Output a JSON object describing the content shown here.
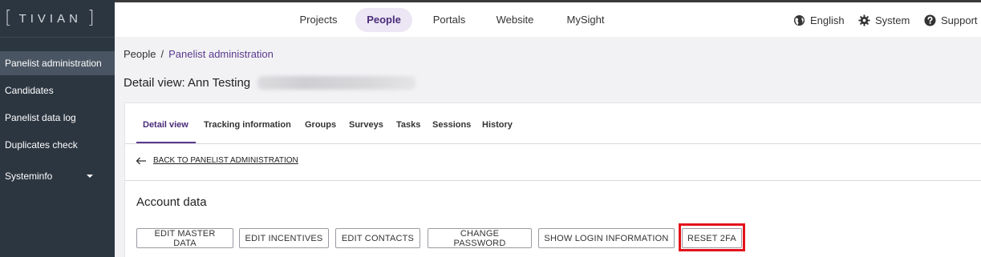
{
  "brand": {
    "logo_text": "TIVIAN",
    "bracket_left": "[",
    "bracket_right": "]"
  },
  "sidebar": {
    "items": [
      {
        "label": "Panelist administration",
        "active": true
      },
      {
        "label": "Candidates"
      },
      {
        "label": "Panelist data log"
      },
      {
        "label": "Duplicates check"
      },
      {
        "label": "Systeminfo",
        "has_dropdown": true
      }
    ]
  },
  "topnav": {
    "items": [
      {
        "label": "Projects"
      },
      {
        "label": "People",
        "active": true
      },
      {
        "label": "Portals"
      },
      {
        "label": "Website"
      },
      {
        "label": "MySight"
      }
    ],
    "language": {
      "label": "English",
      "icon": "globe-icon"
    },
    "system": {
      "label": "System",
      "icon": "gear-icon"
    },
    "support": {
      "label": "Support",
      "icon": "help-icon"
    }
  },
  "breadcrumb": {
    "root": "People",
    "separator": "/",
    "current": "Panelist administration"
  },
  "page": {
    "title": "Detail view: Ann Testing"
  },
  "tabs": [
    {
      "label": "Detail view",
      "active": true
    },
    {
      "label": "Tracking information"
    },
    {
      "label": "Groups"
    },
    {
      "label": "Surveys"
    },
    {
      "label": "Tasks"
    },
    {
      "label": "Sessions"
    },
    {
      "label": "History"
    }
  ],
  "back_link": {
    "label": "BACK TO PANELIST ADMINISTRATION",
    "icon": "arrow-left-icon"
  },
  "section": {
    "title": "Account data"
  },
  "buttons": [
    {
      "label": "EDIT MASTER DATA"
    },
    {
      "label": "EDIT INCENTIVES"
    },
    {
      "label": "EDIT CONTACTS"
    },
    {
      "label": "CHANGE PASSWORD"
    },
    {
      "label": "SHOW LOGIN INFORMATION"
    },
    {
      "label": "RESET 2FA",
      "highlighted": true
    }
  ],
  "colors": {
    "accent": "#5b3a8c",
    "sidebar_bg": "#2c3641",
    "highlight": "#e3121b"
  }
}
